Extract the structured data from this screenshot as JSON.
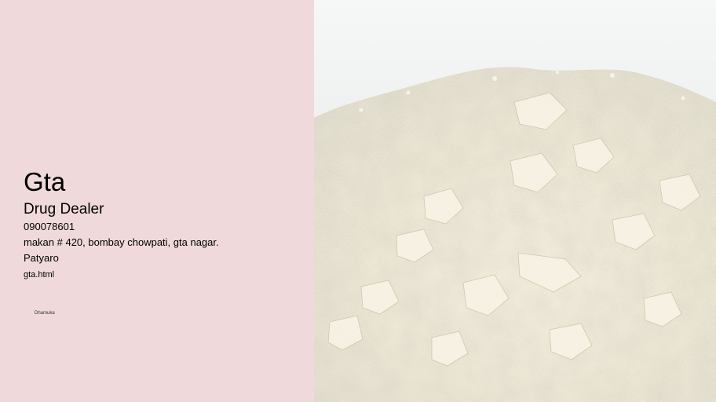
{
  "listing": {
    "title": "Gta",
    "category": "Drug Dealer",
    "phone": "090078601",
    "address": "makan # 420, bombay chowpati, gta nagar.",
    "area": "Patyaro",
    "link": "gta.html",
    "footer": "Dhamuka"
  },
  "photo": {
    "subject": "white-powder-pile"
  },
  "colors": {
    "panel_background": "#f0d9da",
    "text": "#000000",
    "photo_backdrop": "#f3f4f3"
  }
}
